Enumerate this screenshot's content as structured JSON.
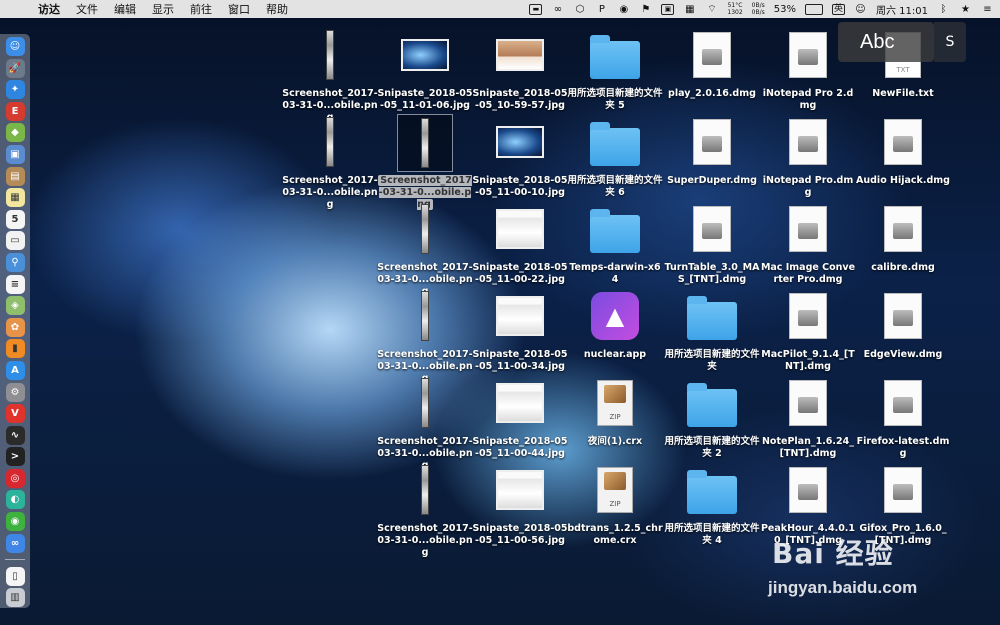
{
  "menubar": {
    "app_name": "访达",
    "items": [
      "文件",
      "编辑",
      "显示",
      "前往",
      "窗口",
      "帮助"
    ],
    "status": {
      "temp": "51°C",
      "fan": "1302",
      "net_up": "0B/s",
      "net_down": "0B/s",
      "battery": "53%",
      "ime": "英",
      "clock": "周六 11:01"
    }
  },
  "ime_popup": {
    "text": "Abc"
  },
  "desktop": {
    "icons": [
      {
        "label": "Screenshot_2017-03-31-0...obile.png",
        "kind": "strip"
      },
      {
        "label": "Snipaste_2018-05-05_11-01-06.jpg",
        "kind": "wide"
      },
      {
        "label": "Snipaste_2018-05-05_10-59-57.jpg",
        "kind": "mountain"
      },
      {
        "label": "用所选项目新建的文件夹 5",
        "kind": "folder"
      },
      {
        "label": "play_2.0.16.dmg",
        "kind": "dmg"
      },
      {
        "label": "iNotepad Pro 2.dmg",
        "kind": "dmg"
      },
      {
        "label": "NewFile.txt",
        "kind": "txt"
      },
      {
        "label": "Screenshot_2017-03-31-0...obile.png",
        "kind": "strip"
      },
      {
        "label": "Screenshot_2017-03-31-0...obile.png",
        "kind": "strip-selected"
      },
      {
        "label": "Snipaste_2018-05-05_11-00-10.jpg",
        "kind": "wide"
      },
      {
        "label": "用所选项目新建的文件夹 6",
        "kind": "folder"
      },
      {
        "label": "SuperDuper.dmg",
        "kind": "dmg"
      },
      {
        "label": "iNotepad Pro.dmg",
        "kind": "dmg"
      },
      {
        "label": "Audio Hijack.dmg",
        "kind": "dmg"
      },
      {
        "label": "Screenshot_2017-03-31-0...obile.png",
        "kind": "strip"
      },
      {
        "label": "Snipaste_2018-05-05_11-00-22.jpg",
        "kind": "light"
      },
      {
        "label": "Temps-darwin-x64",
        "kind": "folder"
      },
      {
        "label": "TurnTable_3.0_MAS_[TNT].dmg",
        "kind": "dmg"
      },
      {
        "label": "Mac Image Converter Pro.dmg",
        "kind": "dmg"
      },
      {
        "label": "calibre.dmg",
        "kind": "dmg"
      },
      {
        "label": "Screenshot_2017-03-31-0...obile.png",
        "kind": "strip"
      },
      {
        "label": "Snipaste_2018-05-05_11-00-34.jpg",
        "kind": "light"
      },
      {
        "label": "nuclear.app",
        "kind": "nuclear"
      },
      {
        "label": "用所选项目新建的文件夹",
        "kind": "folder"
      },
      {
        "label": "MacPilot_9.1.4_[TNT].dmg",
        "kind": "dmg"
      },
      {
        "label": "EdgeView.dmg",
        "kind": "dmg"
      },
      {
        "label": "Screenshot_2017-03-31-0...obile.png",
        "kind": "strip"
      },
      {
        "label": "Snipaste_2018-05-05_11-00-44.jpg",
        "kind": "light"
      },
      {
        "label": "夜间(1).crx",
        "kind": "zip"
      },
      {
        "label": "用所选项目新建的文件夹 2",
        "kind": "folder"
      },
      {
        "label": "NotePlan_1.6.24_[TNT].dmg",
        "kind": "dmg"
      },
      {
        "label": "Firefox-latest.dmg",
        "kind": "dmg"
      },
      {
        "label": "Screenshot_2017-03-31-0...obile.png",
        "kind": "strip"
      },
      {
        "label": "Snipaste_2018-05-05_11-00-56.jpg",
        "kind": "light"
      },
      {
        "label": "bdtrans_1.2.5_chrome.crx",
        "kind": "zip"
      },
      {
        "label": "用所选项目新建的文件夹 4",
        "kind": "folder"
      },
      {
        "label": "PeakHour_4.4.0.10_[TNT].dmg",
        "kind": "dmg"
      },
      {
        "label": "Gifox_Pro_1.6.0_[TNT].dmg",
        "kind": "dmg"
      }
    ]
  },
  "dock": {
    "apps": [
      {
        "name": "finder-icon",
        "color": "#3d8ee8",
        "glyph": "☺"
      },
      {
        "name": "launchpad-icon",
        "color": "#6d7a8c",
        "glyph": "🚀"
      },
      {
        "name": "safari-icon",
        "color": "#2f86e0",
        "glyph": "✦"
      },
      {
        "name": "app-red-icon",
        "color": "#d63b2f",
        "glyph": "E"
      },
      {
        "name": "android-icon",
        "color": "#7ab648",
        "glyph": "◆"
      },
      {
        "name": "preview-icon",
        "color": "#5b8ccf",
        "glyph": "▣"
      },
      {
        "name": "notes-brown-icon",
        "color": "#b58b58",
        "glyph": "▤"
      },
      {
        "name": "stickies-icon",
        "color": "#f3e7a0",
        "glyph": "▦"
      },
      {
        "name": "calendar-icon",
        "color": "#f5f5f5",
        "glyph": "5"
      },
      {
        "name": "notes-icon",
        "color": "#f2f2f2",
        "glyph": "▭"
      },
      {
        "name": "search-app-icon",
        "color": "#4a90d9",
        "glyph": "⚲"
      },
      {
        "name": "reminders-icon",
        "color": "#f5f5f5",
        "glyph": "≡"
      },
      {
        "name": "maps-icon",
        "color": "#8fbf6d",
        "glyph": "◈"
      },
      {
        "name": "photos-icon",
        "color": "#e8934a",
        "glyph": "✿"
      },
      {
        "name": "ibooks-icon",
        "color": "#f08a24",
        "glyph": "▮"
      },
      {
        "name": "app-store-icon",
        "color": "#2f8ee8",
        "glyph": "A"
      },
      {
        "name": "system-preferences-icon",
        "color": "#8e8e93",
        "glyph": "⚙"
      },
      {
        "name": "vivaldi-icon",
        "color": "#e0332b",
        "glyph": "V"
      },
      {
        "name": "activity-monitor-icon",
        "color": "#2b2b2b",
        "glyph": "∿"
      },
      {
        "name": "terminal-icon",
        "color": "#222222",
        "glyph": ">"
      },
      {
        "name": "netease-music-icon",
        "color": "#d7282f",
        "glyph": "◎"
      },
      {
        "name": "app-green-icon",
        "color": "#2bb39b",
        "glyph": "◐"
      },
      {
        "name": "wechat-icon",
        "color": "#3fb13f",
        "glyph": "◉"
      },
      {
        "name": "baidu-netdisk-icon",
        "color": "#3f86e6",
        "glyph": "∞"
      }
    ],
    "trailing": [
      {
        "name": "document-icon",
        "color": "#f5f5f5",
        "glyph": "▯"
      },
      {
        "name": "trash-icon",
        "color": "#c9cdd3",
        "glyph": "▥"
      }
    ]
  },
  "watermark": {
    "brand": "Bai 经验",
    "url": "jingyan.baidu.com"
  },
  "colors": {
    "menubar_bg": "#ececec",
    "folder_blue": "#3ea4e8",
    "selection_label": "#d2d2d2"
  }
}
